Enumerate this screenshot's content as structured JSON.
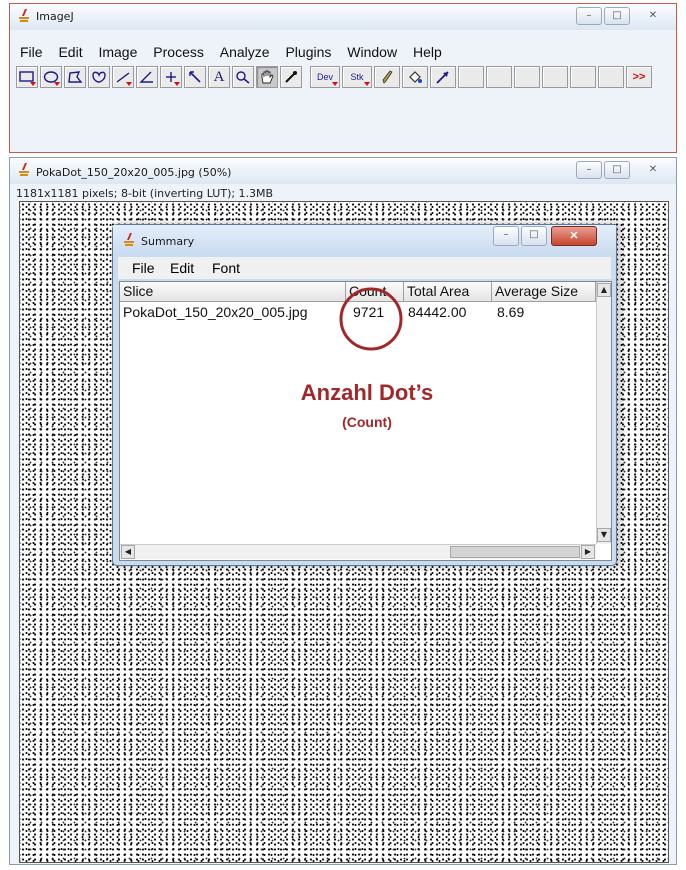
{
  "imagej": {
    "title": "ImageJ",
    "menu": [
      "File",
      "Edit",
      "Image",
      "Process",
      "Analyze",
      "Plugins",
      "Window",
      "Help"
    ],
    "tools": {
      "text": "A",
      "dev": "Dev",
      "stk": "Stk",
      "more": ">>"
    }
  },
  "image_window": {
    "title": "PokaDot_150_20x20_005.jpg (50%)",
    "info": "1181x1181 pixels; 8-bit (inverting LUT); 1.3MB"
  },
  "summary": {
    "title": "Summary",
    "menu": [
      "File",
      "Edit",
      "Font"
    ],
    "columns": [
      "Slice",
      "Count",
      "Total Area",
      "Average Size"
    ],
    "rows": [
      [
        "PokaDot_150_20x20_005.jpg",
        "9721",
        "84442.00",
        "8.69"
      ]
    ]
  },
  "annotation": {
    "title": "Anzahl Dot’s",
    "subtitle": "(Count)",
    "color": "#a1282a"
  },
  "colors": {
    "window_border": "#8a9bb3",
    "close_red": "#c7442f",
    "tool_red": "#d01010"
  },
  "icons": [
    "imagej-logo-icon",
    "minimize-icon",
    "maximize-icon",
    "close-icon"
  ]
}
